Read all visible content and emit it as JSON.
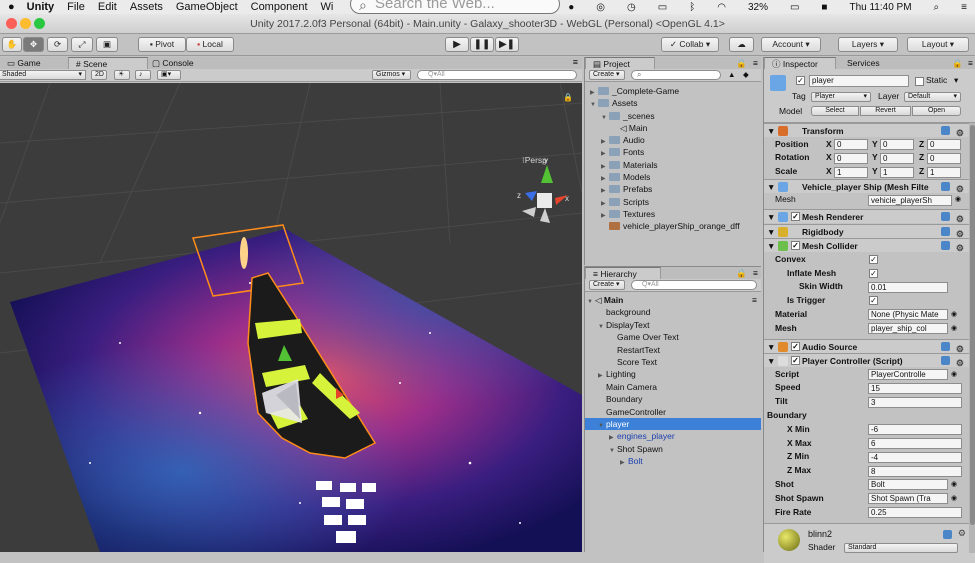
{
  "menubar": {
    "apple": "",
    "app": "Unity",
    "items": [
      "File",
      "Edit",
      "Assets",
      "GameObject",
      "Component",
      "Wi"
    ],
    "battery": "32%",
    "clock": "Thu 11:40 PM"
  },
  "search": {
    "placeholder": "Search the Web..."
  },
  "window": {
    "title": "Unity 2017.2.0f3 Personal (64bit) - Main.unity - Galaxy_shooter3D - WebGL (Personal) <OpenGL 4.1>"
  },
  "toolbar": {
    "pivot": "Pivot",
    "local": "Local",
    "collab": "Collab",
    "account": "Account",
    "layers": "Layers",
    "layout": "Layout"
  },
  "scene": {
    "tabs": [
      "Game",
      "Scene",
      "Console"
    ],
    "shading": "Shaded",
    "mode2d": "2D",
    "gizmos": "Gizmos",
    "search_ph": "Q▾All",
    "persp": "Persp",
    "axes": {
      "y": "y",
      "x": "x",
      "z": "z"
    }
  },
  "project": {
    "tab": "Project",
    "create": "Create",
    "search_ph": "",
    "items": [
      {
        "label": "_Complete-Game",
        "depth": 0,
        "arrow": "▶",
        "type": "folder"
      },
      {
        "label": "Assets",
        "depth": 0,
        "arrow": "▼",
        "type": "folder"
      },
      {
        "label": "_scenes",
        "depth": 1,
        "arrow": "▼",
        "type": "folder"
      },
      {
        "label": "Main",
        "depth": 2,
        "arrow": "",
        "type": "unity"
      },
      {
        "label": "Audio",
        "depth": 1,
        "arrow": "▶",
        "type": "folder"
      },
      {
        "label": "Fonts",
        "depth": 1,
        "arrow": "▶",
        "type": "folder"
      },
      {
        "label": "Materials",
        "depth": 1,
        "arrow": "▶",
        "type": "folder"
      },
      {
        "label": "Models",
        "depth": 1,
        "arrow": "▶",
        "type": "folder"
      },
      {
        "label": "Prefabs",
        "depth": 1,
        "arrow": "▶",
        "type": "folder"
      },
      {
        "label": "Scripts",
        "depth": 1,
        "arrow": "▶",
        "type": "folder"
      },
      {
        "label": "Textures",
        "depth": 1,
        "arrow": "▶",
        "type": "folder"
      },
      {
        "label": "vehicle_playerShip_orange_dff",
        "depth": 1,
        "arrow": "",
        "type": "texture"
      }
    ]
  },
  "hierarchy": {
    "tab": "Hierarchy",
    "create": "Create",
    "search_ph": "Q▾All",
    "items": [
      {
        "label": "Main",
        "depth": 0,
        "arrow": "▼",
        "bold": true
      },
      {
        "label": "background",
        "depth": 1,
        "arrow": ""
      },
      {
        "label": "DisplayText",
        "depth": 1,
        "arrow": "▼"
      },
      {
        "label": "Game Over Text",
        "depth": 2,
        "arrow": ""
      },
      {
        "label": "RestartText",
        "depth": 2,
        "arrow": ""
      },
      {
        "label": "Score Text",
        "depth": 2,
        "arrow": ""
      },
      {
        "label": "Lighting",
        "depth": 1,
        "arrow": "▶"
      },
      {
        "label": "Main Camera",
        "depth": 1,
        "arrow": ""
      },
      {
        "label": "Boundary",
        "depth": 1,
        "arrow": ""
      },
      {
        "label": "GameController",
        "depth": 1,
        "arrow": ""
      },
      {
        "label": "player",
        "depth": 1,
        "arrow": "▼",
        "selected": true
      },
      {
        "label": "engines_player",
        "depth": 2,
        "arrow": "▶",
        "blue": true
      },
      {
        "label": "Shot Spawn",
        "depth": 2,
        "arrow": "▼"
      },
      {
        "label": "Bolt",
        "depth": 3,
        "arrow": "▶",
        "blue": true
      }
    ]
  },
  "inspector": {
    "tabs": [
      "Inspector",
      "Services"
    ],
    "name": "player",
    "static": "Static",
    "tag_label": "Tag",
    "tag": "Player",
    "layer_label": "Layer",
    "layer": "Default",
    "model_label": "Model",
    "select": "Select",
    "revert": "Revert",
    "open": "Open",
    "transform": {
      "title": "Transform",
      "position": "Position",
      "rotation": "Rotation",
      "scale": "Scale",
      "x": "X",
      "y": "Y",
      "z": "Z",
      "pos": [
        "0",
        "0",
        "0"
      ],
      "rot": [
        "0",
        "0",
        "0"
      ],
      "scl": [
        "1",
        "1",
        "1"
      ]
    },
    "meshfilter": {
      "title": "Vehicle_player Ship (Mesh Filte",
      "mesh_label": "Mesh",
      "mesh": "vehicle_playerSh"
    },
    "meshrenderer": "Mesh Renderer",
    "rigidbody": "Rigidbody",
    "meshcollider": {
      "title": "Mesh Collider",
      "convex": "Convex",
      "inflate": "Inflate Mesh",
      "skin": "Skin Width",
      "skin_val": "0.01",
      "trigger": "Is Trigger",
      "material_label": "Material",
      "material": "None (Physic Mate",
      "mesh_label": "Mesh",
      "mesh": "player_ship_col"
    },
    "audio": "Audio Source",
    "controller": {
      "title": "Player Controller (Script)",
      "script_label": "Script",
      "script": "PlayerControlle",
      "speed_label": "Speed",
      "speed": "15",
      "tilt_label": "Tilt",
      "tilt": "3",
      "boundary": "Boundary",
      "xmin_l": "X Min",
      "xmin": "-6",
      "xmax_l": "X Max",
      "xmax": "6",
      "zmin_l": "Z Min",
      "zmin": "-4",
      "zmax_l": "Z Max",
      "zmax": "8",
      "shot_l": "Shot",
      "shot": "Bolt",
      "spawn_l": "Shot Spawn",
      "spawn": "Shot Spawn (Tra",
      "rate_l": "Fire Rate",
      "rate": "0.25"
    },
    "material": {
      "name": "blinn2",
      "shader_l": "Shader",
      "shader": "Standard"
    }
  },
  "colors": {
    "accent": "#3d80d8",
    "selected": "#3d80d8"
  }
}
